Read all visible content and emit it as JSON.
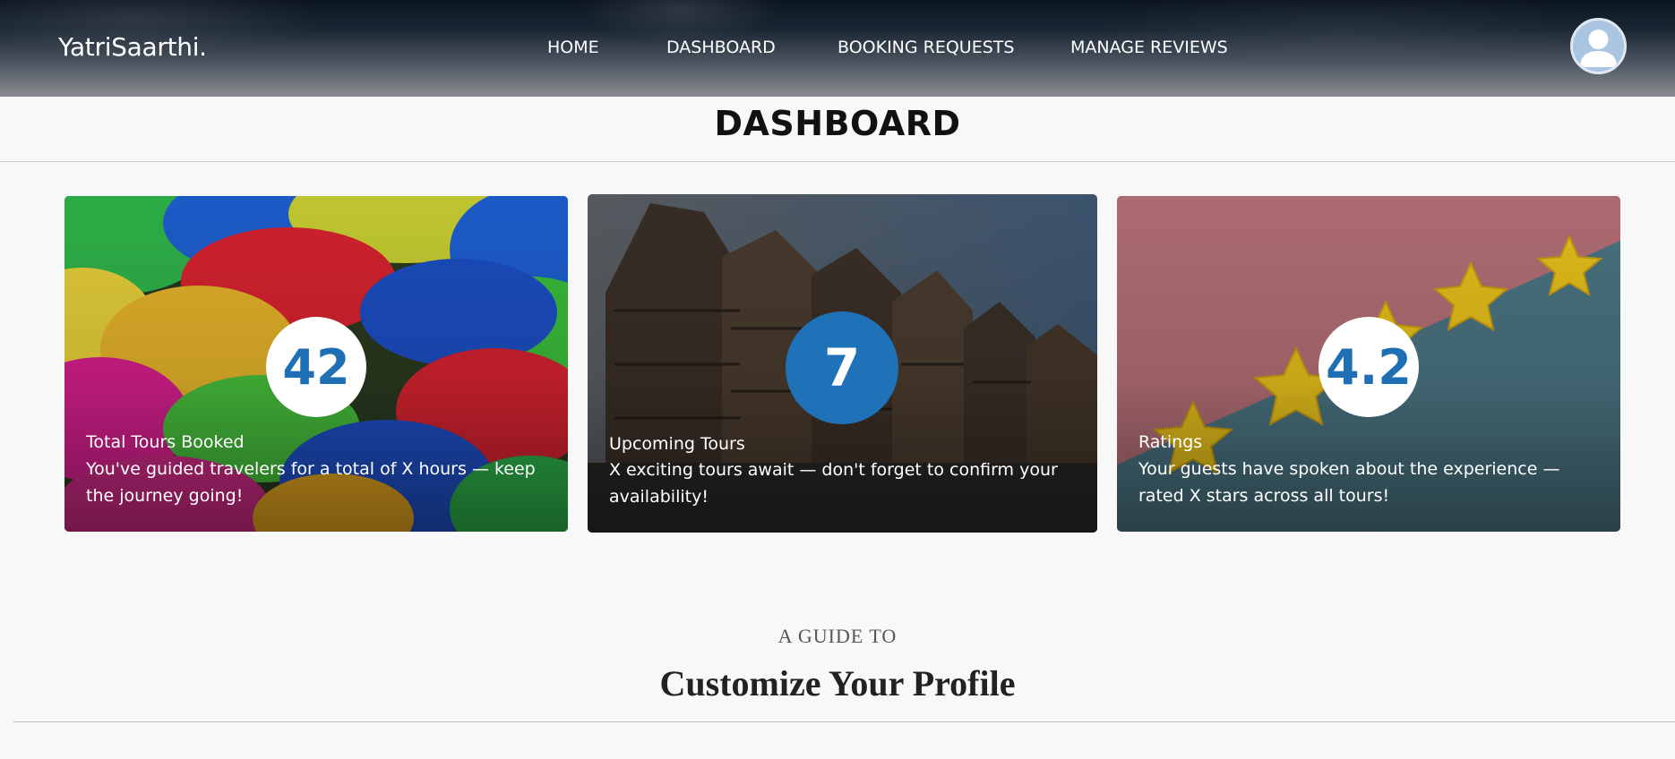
{
  "header": {
    "brand": "YatriSaarthi.",
    "nav": [
      "HOME",
      "DASHBOARD",
      "BOOKING REQUESTS",
      "MANAGE REVIEWS"
    ],
    "avatar_icon": "user-avatar-icon"
  },
  "page": {
    "title": "DASHBOARD"
  },
  "cards": [
    {
      "value": "42",
      "title": "Total Tours Booked",
      "description": "You've guided travelers for a total of X hours — keep the journey going!",
      "image": "umbrellas-photo"
    },
    {
      "value": "7",
      "title": "Upcoming Tours",
      "description": "X exciting tours await — don't forget to confirm your availability!",
      "image": "timber-houses-photo"
    },
    {
      "value": "4.2",
      "title": "Ratings",
      "description": "Your guests have spoken about the experience — rated X stars across all tours!",
      "image": "stars-photo"
    }
  ],
  "guide": {
    "eyebrow": "A GUIDE TO",
    "title": "Customize Your Profile"
  },
  "colors": {
    "accent": "#1f72b8",
    "background": "#f8f8f8"
  }
}
